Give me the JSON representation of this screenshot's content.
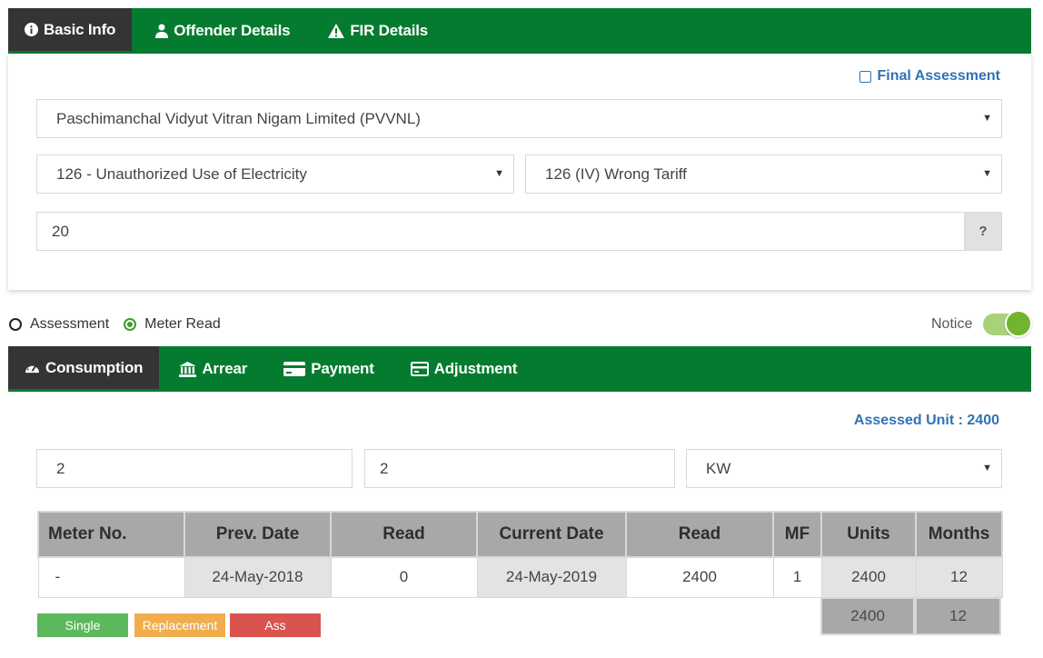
{
  "top_tabs": [
    {
      "label": "Basic Info",
      "icon": "info-circle-icon"
    },
    {
      "label": "Offender Details",
      "icon": "user-icon"
    },
    {
      "label": "FIR Details",
      "icon": "warning-icon"
    }
  ],
  "basic_info": {
    "final_assessment_label": "Final Assessment",
    "discom_value": "Paschimanchal Vidyut Vitran Nigam Limited (PVVNL)",
    "section_value": "126 - Unauthorized Use of Electricity",
    "subsection_value": "126 (IV) Wrong Tariff",
    "number_value": "20",
    "help_label": "?"
  },
  "mode": {
    "options": [
      {
        "label": "Assessment",
        "checked": false
      },
      {
        "label": "Meter Read",
        "checked": true
      }
    ],
    "notice_label": "Notice",
    "notice_on": true
  },
  "bottom_tabs": [
    {
      "label": "Consumption",
      "icon": "gauge-icon"
    },
    {
      "label": "Arrear",
      "icon": "bank-icon"
    },
    {
      "label": "Payment",
      "icon": "credit-card-icon"
    },
    {
      "label": "Adjustment",
      "icon": "card-icon"
    }
  ],
  "consumption": {
    "assessed_unit_label": "Assessed Unit : 2400",
    "input1_value": "2",
    "input2_value": "2",
    "unit_select_value": "KW",
    "table": {
      "headers": [
        "Meter No.",
        "Prev. Date",
        "Read",
        "Current Date",
        "Read",
        "MF",
        "Units",
        "Months"
      ],
      "row": [
        "-",
        "24-May-2018",
        "0",
        "24-May-2019",
        "2400",
        "1",
        "2400",
        "12"
      ],
      "totals": [
        "2400",
        "12"
      ]
    },
    "buttons": [
      {
        "label": "Single",
        "color": "#5cb85c"
      },
      {
        "label": "Replacement",
        "color": "#f0ad4e"
      },
      {
        "label": "Ass",
        "color": "#d9534f"
      }
    ]
  },
  "colors": {
    "green_bar": "#057b2f",
    "active_tab": "#343434",
    "link_blue": "#2f72b7"
  }
}
